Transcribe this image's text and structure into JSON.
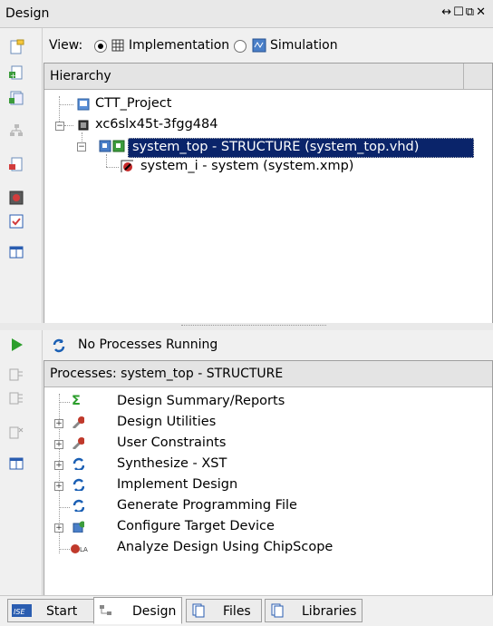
{
  "window": {
    "title": "Design"
  },
  "view": {
    "label": "View:",
    "options": [
      {
        "label": "Implementation",
        "selected": true
      },
      {
        "label": "Simulation",
        "selected": false
      }
    ]
  },
  "hierarchy": {
    "header": "Hierarchy",
    "nodes": [
      {
        "label": "CTT_Project"
      },
      {
        "label": "xc6slx45t-3fgg484"
      },
      {
        "label": "system_top - STRUCTURE (system_top.vhd)",
        "selected": true
      },
      {
        "label": "system_i - system (system.xmp)"
      }
    ]
  },
  "status": {
    "running": "No Processes Running"
  },
  "processes": {
    "header": "Processes: system_top - STRUCTURE",
    "items": [
      {
        "label": "Design Summary/Reports"
      },
      {
        "label": "Design Utilities"
      },
      {
        "label": "User Constraints"
      },
      {
        "label": "Synthesize - XST"
      },
      {
        "label": "Implement Design"
      },
      {
        "label": "Generate Programming File"
      },
      {
        "label": "Configure Target Device"
      },
      {
        "label": "Analyze Design Using ChipScope"
      }
    ]
  },
  "tabs": [
    {
      "label": "Start"
    },
    {
      "label": "Design",
      "active": true
    },
    {
      "label": "Files"
    },
    {
      "label": "Libraries"
    }
  ],
  "colors": {
    "selection": "#0a246a",
    "accent_green": "#2c9e2c",
    "sync_blue": "#1a5fb4"
  }
}
